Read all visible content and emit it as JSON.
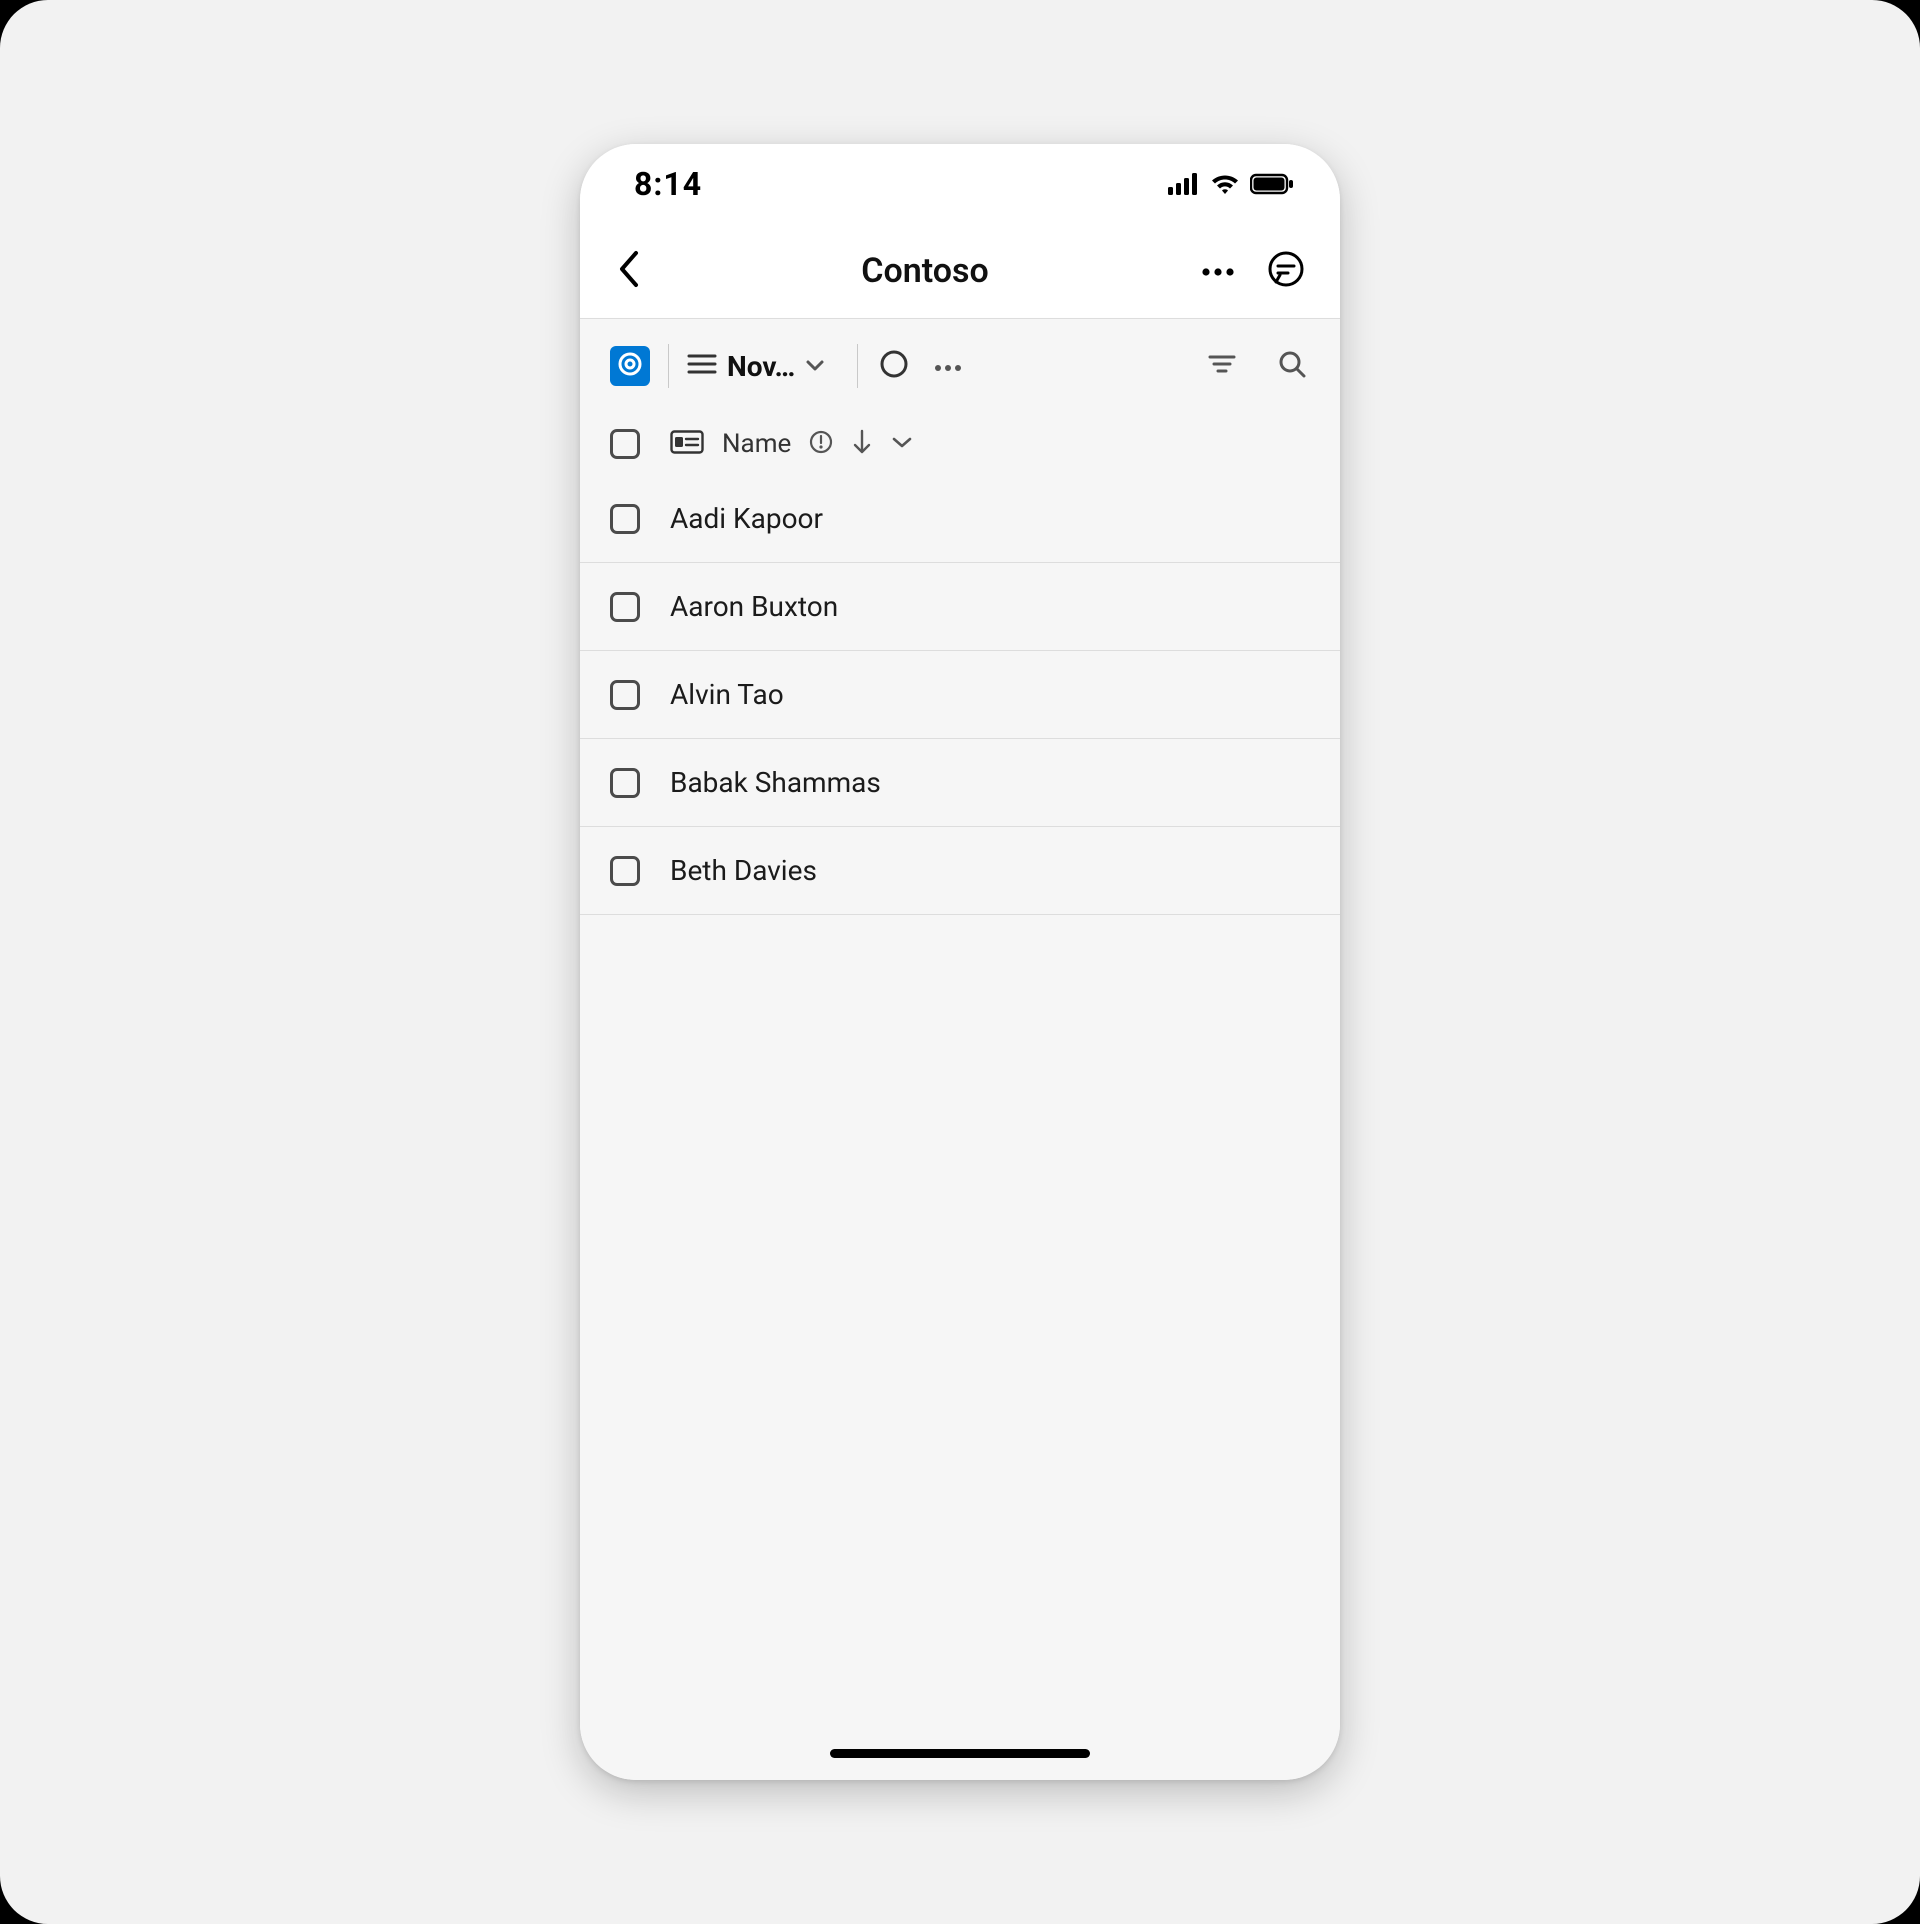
{
  "status": {
    "time": "8:14"
  },
  "nav": {
    "title": "Contoso"
  },
  "toolbar": {
    "view_label": "Nov…"
  },
  "list": {
    "column_header": "Name",
    "rows": [
      {
        "name": "Aadi Kapoor"
      },
      {
        "name": "Aaron Buxton"
      },
      {
        "name": "Alvin Tao"
      },
      {
        "name": "Babak Shammas"
      },
      {
        "name": "Beth Davies"
      }
    ]
  }
}
